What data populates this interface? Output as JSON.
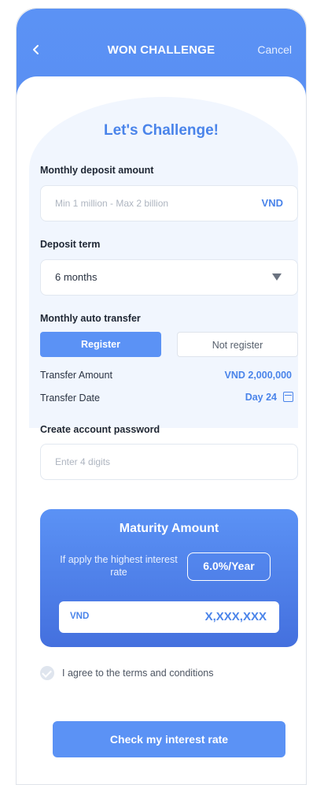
{
  "header": {
    "title": "WON CHALLENGE",
    "cancel_label": "Cancel",
    "back_icon": "chevron-left-icon"
  },
  "heading": "Let's Challenge!",
  "deposit": {
    "label": "Monthly deposit amount",
    "placeholder": "Min 1 million - Max 2 billion",
    "currency": "VND"
  },
  "term": {
    "label": "Deposit term",
    "selected": "6 months"
  },
  "auto_transfer": {
    "label": "Monthly auto transfer",
    "options": [
      "Register",
      "Not register"
    ],
    "selected": "Register",
    "amount_label": "Transfer Amount",
    "amount_value": "VND 2,000,000",
    "date_label": "Transfer Date",
    "date_value": "Day 24"
  },
  "password": {
    "label": "Create account password",
    "placeholder": "Enter 4 digits"
  },
  "maturity": {
    "title": "Maturity Amount",
    "note": "If apply the highest interest rate",
    "rate": "6.0%/Year",
    "currency": "VND",
    "amount": "X,XXX,XXX"
  },
  "agree_label": "I agree to the terms and conditions",
  "cta_label": "Check my interest rate",
  "colors": {
    "accent": "#5b92f5",
    "accent_text": "#4a84ea",
    "background_tint": "#f1f6fe"
  }
}
